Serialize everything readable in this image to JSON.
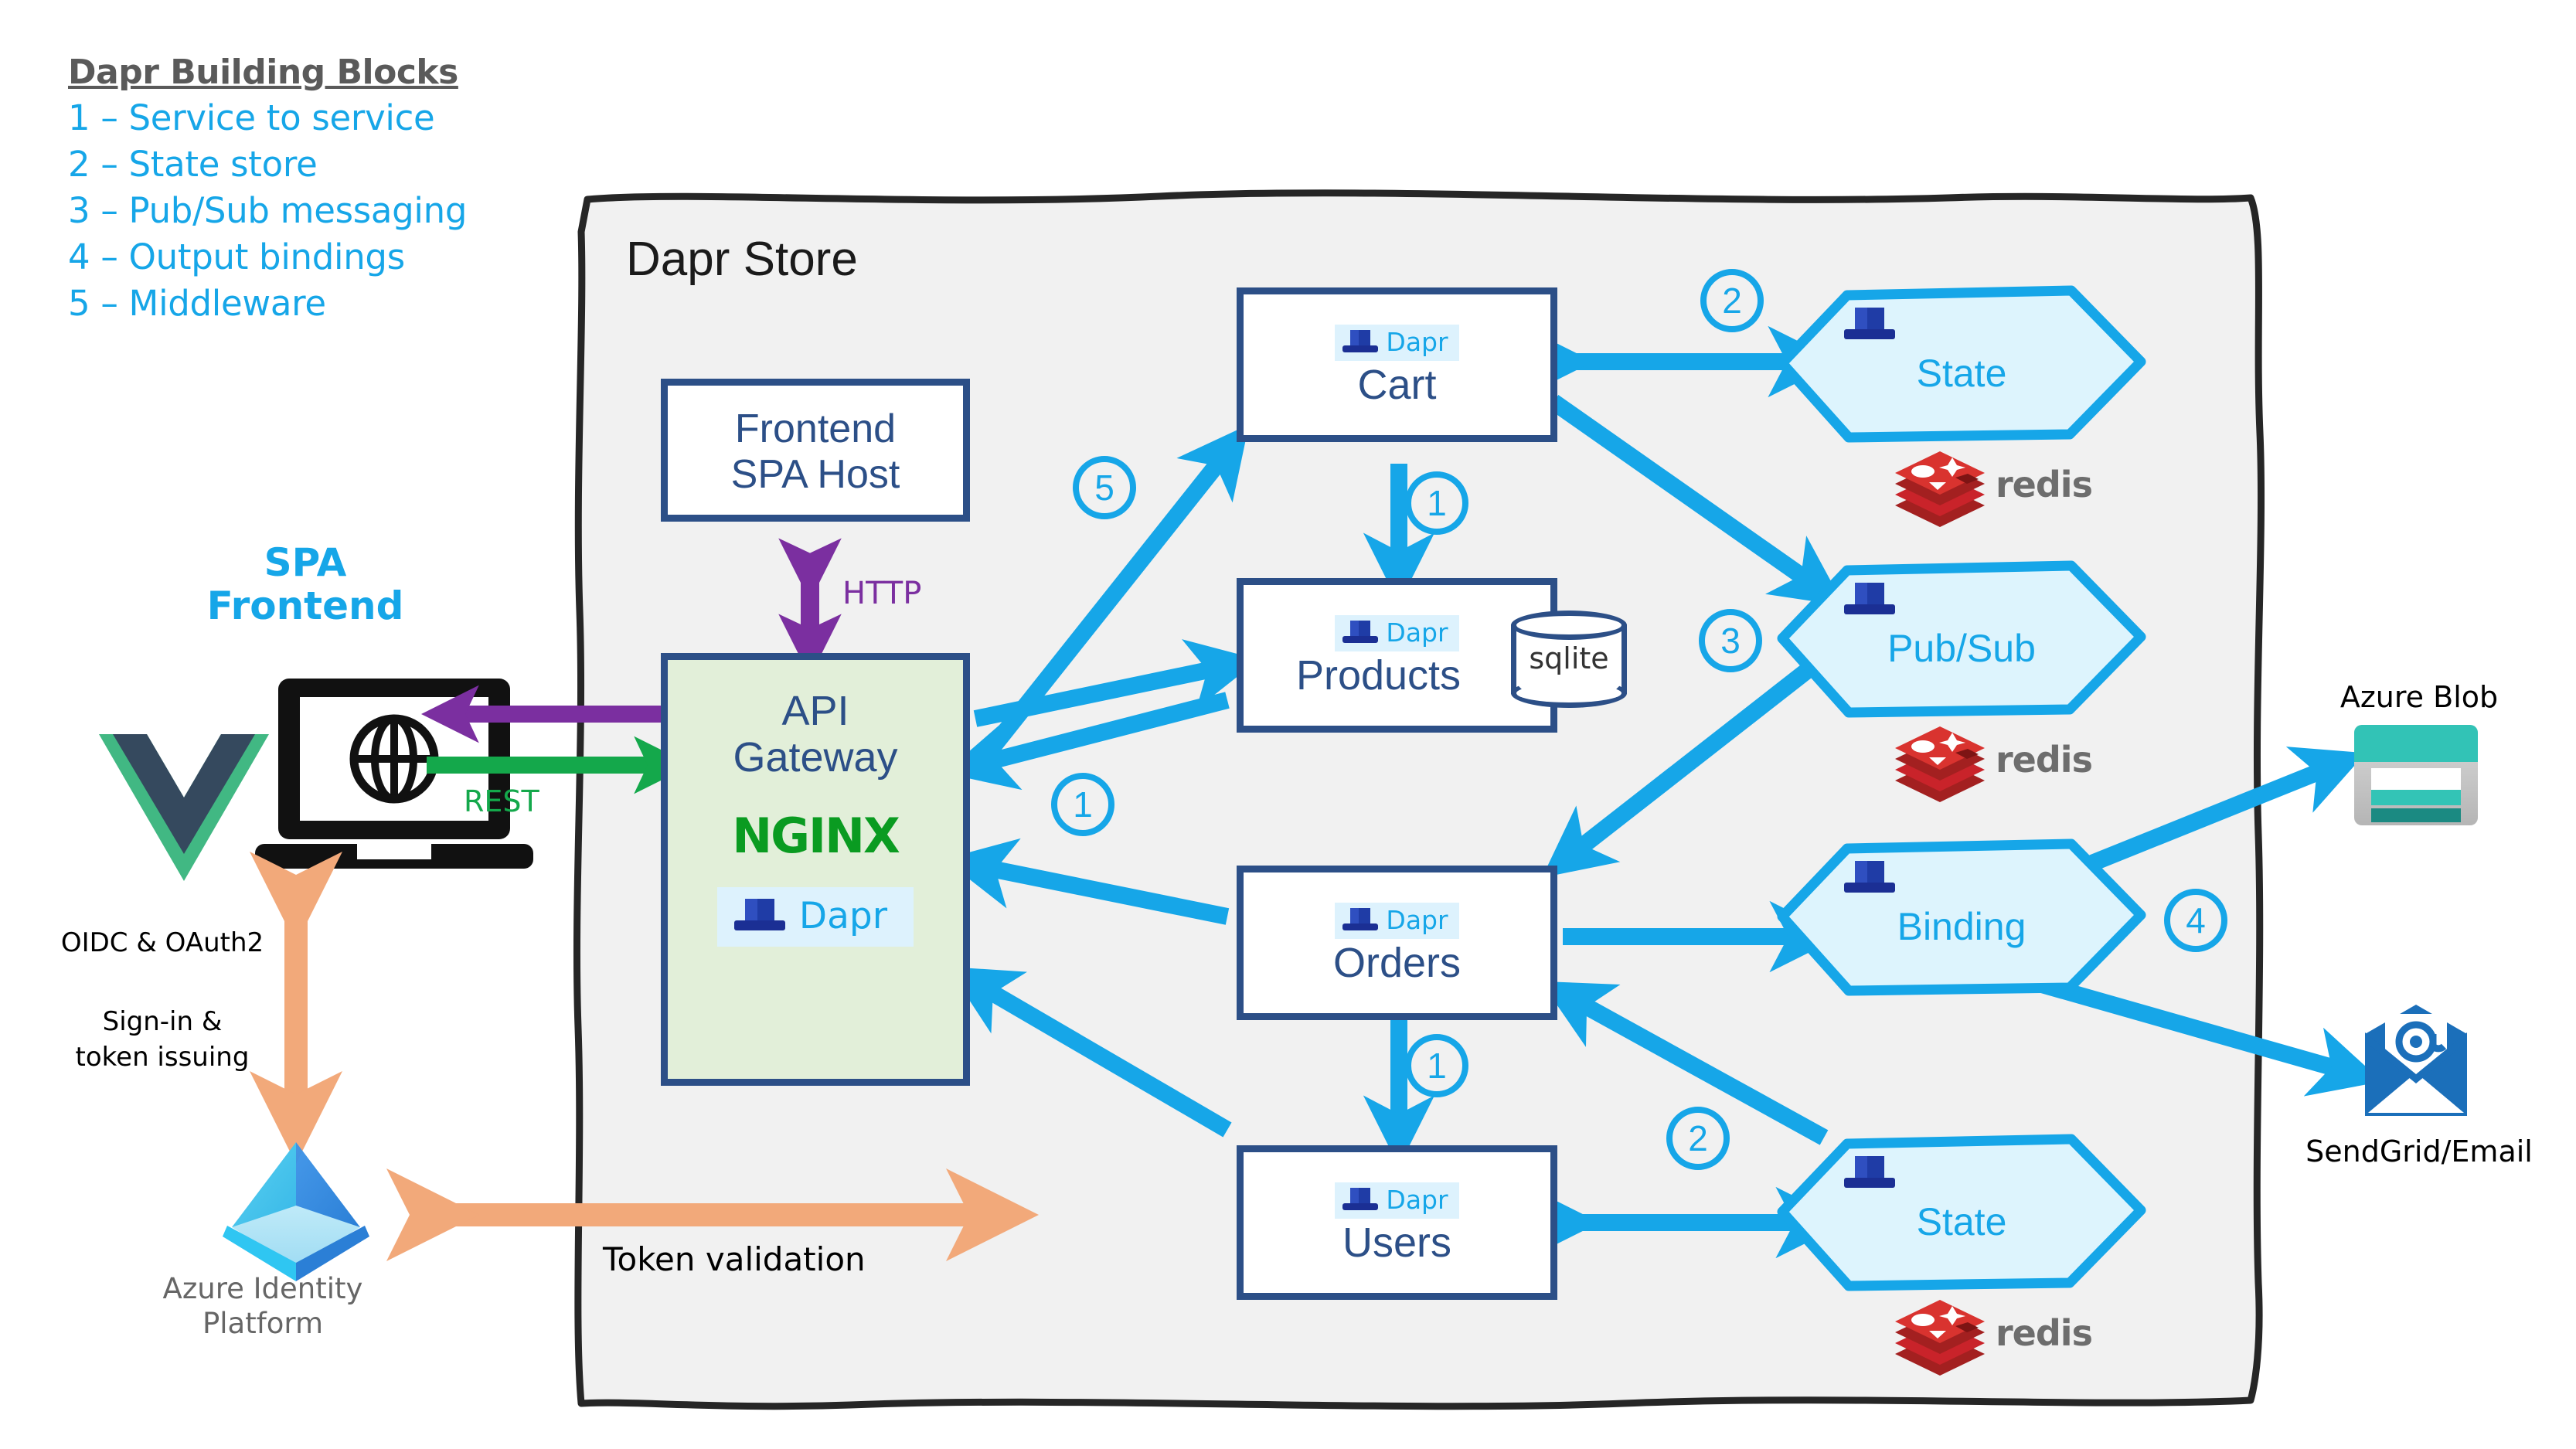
{
  "legend": {
    "title": "Dapr Building Blocks",
    "items": [
      "1 – Service to service",
      "2 – State store",
      "3 – Pub/Sub messaging",
      "4 – Output bindings",
      "5 – Middleware"
    ]
  },
  "client": {
    "spa_title": "SPA\nFrontend",
    "oidc_label": "OIDC & OAuth2",
    "signin_label": "Sign-in &\ntoken issuing",
    "identity_label": "Azure Identity\nPlatform",
    "rest_label": "REST",
    "token_validation_label": "Token validation"
  },
  "container": {
    "title": "Dapr Store"
  },
  "gateway": {
    "spa_host": "Frontend\nSPA Host",
    "http_label": "HTTP",
    "name": "API\nGateway",
    "nginx": "NGINX",
    "dapr_label": "Dapr"
  },
  "services": [
    {
      "id": "cart",
      "name": "Cart",
      "dapr_label": "Dapr"
    },
    {
      "id": "products",
      "name": "Products",
      "dapr_label": "Dapr",
      "db": "sqlite"
    },
    {
      "id": "orders",
      "name": "Orders",
      "dapr_label": "Dapr"
    },
    {
      "id": "users",
      "name": "Users",
      "dapr_label": "Dapr"
    }
  ],
  "components": [
    {
      "id": "state-top",
      "name": "State",
      "backing": "redis"
    },
    {
      "id": "pubsub",
      "name": "Pub/Sub",
      "backing": "redis"
    },
    {
      "id": "binding",
      "name": "Binding",
      "backing": ""
    },
    {
      "id": "state-bottom",
      "name": "State",
      "backing": "redis"
    }
  ],
  "externals": [
    {
      "id": "azure-blob",
      "label": "Azure Blob"
    },
    {
      "id": "sendgrid",
      "label": "SendGrid/Email"
    }
  ],
  "markers": [
    {
      "id": "m-cart-state",
      "n": "2"
    },
    {
      "id": "m-gateway-cart",
      "n": "5"
    },
    {
      "id": "m-cart-products",
      "n": "1"
    },
    {
      "id": "m-pubsub",
      "n": "3"
    },
    {
      "id": "m-gateway-orders",
      "n": "1"
    },
    {
      "id": "m-orders-users",
      "n": "1"
    },
    {
      "id": "m-binding",
      "n": "4"
    },
    {
      "id": "m-users-state",
      "n": "2"
    }
  ],
  "colors": {
    "accent_blue": "#16a6e8",
    "service_border": "#2c4f87",
    "gateway_fill": "#e2efd9",
    "hex_fill": "#ddf4fd",
    "container_fill": "#f1f1f1",
    "nginx_green": "#0a9b21",
    "rest_green": "#14a84b",
    "http_purple": "#7b2fa0",
    "identity_orange": "#f2a97a",
    "redis_red": "#c9232a"
  }
}
